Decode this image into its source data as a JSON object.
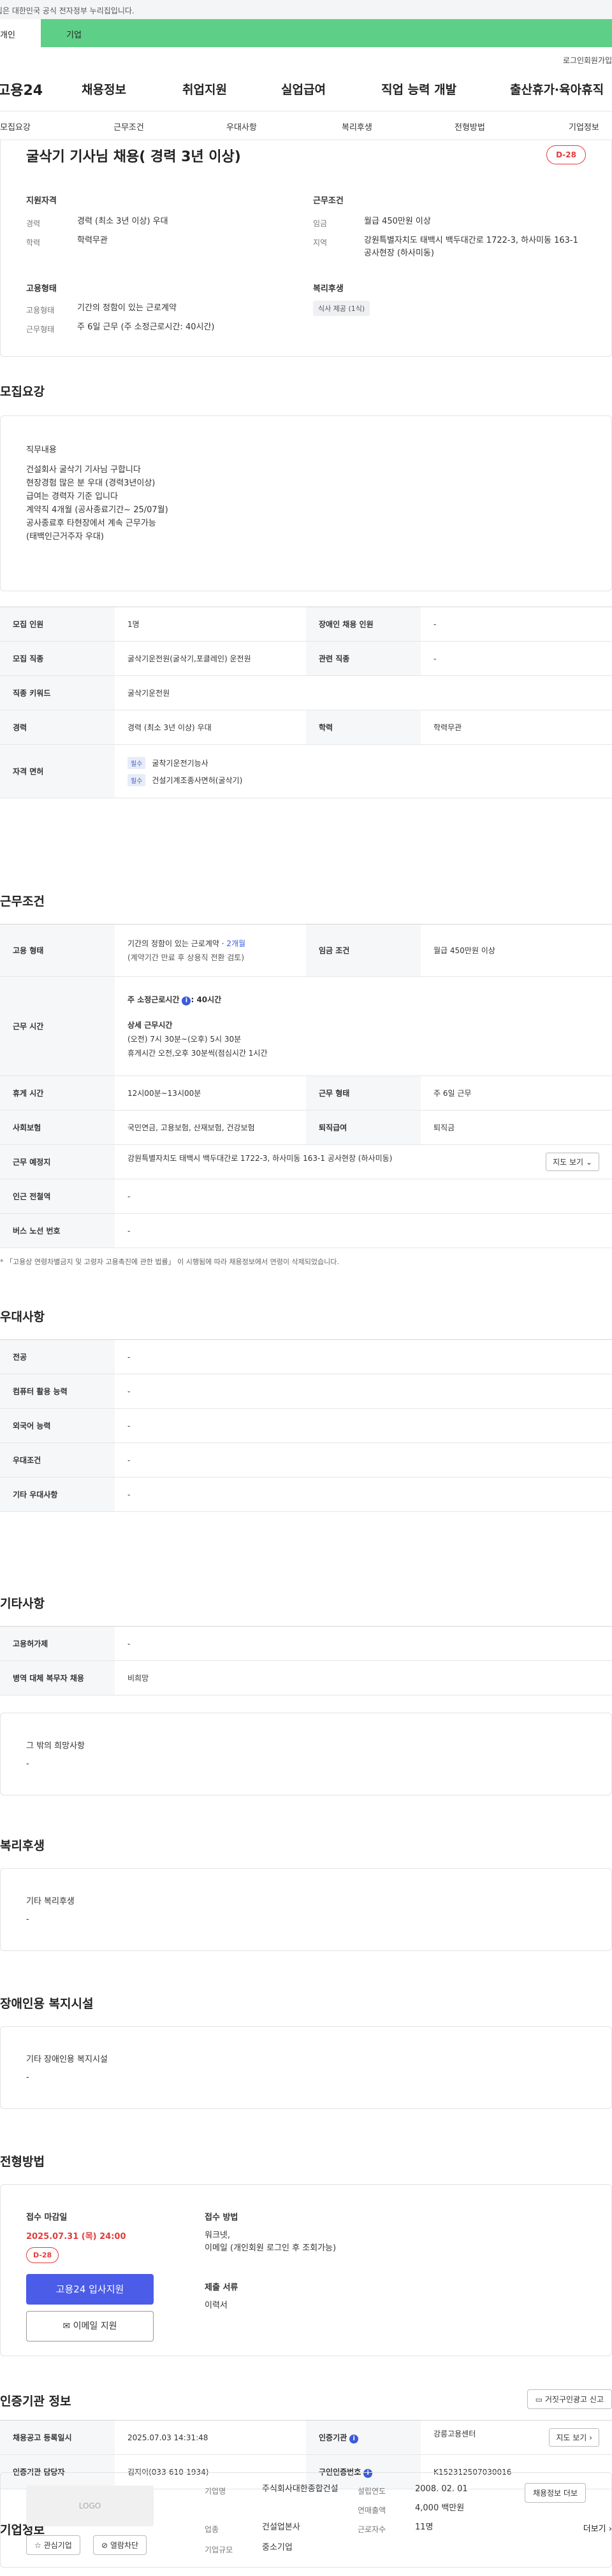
{
  "gov_banner": "이 누리집은 대한민국 공식 전자정부 누리집입니다.",
  "top_tabs": {
    "personal": "개인",
    "company": "기업"
  },
  "util": {
    "login": "로그인",
    "join": "회원가입"
  },
  "gnb": {
    "logo": "고용24",
    "menu": [
      "채용정보",
      "취업지원",
      "실업급여",
      "직업 능력 개발",
      "출산휴가·육아휴직"
    ]
  },
  "subnav": [
    "모집요강",
    "근무조건",
    "우대사항",
    "복리후생",
    "전형방법",
    "기업정보"
  ],
  "job": {
    "title": "굴삭기 기사님 채용( 경력 3년 이상)",
    "dday": "D-28",
    "qual_label": "지원자격",
    "career_k": "경력",
    "career_v": "경력 (최소 3년 이상) 우대",
    "edu_k": "학력",
    "edu_v": "학력무관",
    "work_label": "근무조건",
    "wage_k": "임금",
    "wage_v": "월급 450만원 이상",
    "region_k": "지역",
    "region_v": "강원특별자치도 태백시 백두대간로 1722-3, 하사미동 163-1 공사현장 (하사미동)",
    "emp_label": "고용형태",
    "emp_k": "고용형태",
    "emp_v": "기간의 정함이 있는 근로계약",
    "workform_k": "근무형태",
    "workform_v": "주 6일 근무 (주 소정근로시간: 40시간)",
    "welfare_label": "복리후생",
    "welfare_pill": "식사 제공 (1식)"
  },
  "recruit": {
    "heading": "모집요강",
    "duty_title": "직무내용",
    "duty_text": "건설회사 굴삭기 기사님 구합니다\n현장경험 많은 분 우대 (경력3년이상)\n급여는 경력자 기준 입니다\n계약직 4개월 (공사종료기간~ 25/07월)\n공사종료후 타현장에서 계속 근무가능\n(태백인근거주자 우대)",
    "rows": [
      [
        "모집 인원",
        "1명",
        "장애인 채용 인원",
        "-"
      ],
      [
        "모집 직종",
        "굴삭기운전원(굴삭기,포클레인) 운전원",
        "관련 직종",
        "-"
      ],
      [
        "직종 키워드",
        "굴삭기운전원",
        "",
        ""
      ],
      [
        "경력",
        "경력 (최소 3년 이상) 우대",
        "학력",
        "학력무관"
      ]
    ],
    "license_k": "자격 면허",
    "licenses": [
      "굴착기운전기능사",
      "건설기계조종사면허(굴삭기)"
    ],
    "required_tag": "필수"
  },
  "conditions": {
    "heading": "근무조건",
    "emp_k": "고용 형태",
    "emp_v1": "기간의 정함이 있는 근로계약 · ",
    "emp_v1_blue": "2개월",
    "emp_v2": "(계약기간 만료 후 상용직 전환 검토)",
    "wage_k": "임금 조건",
    "wage_v": "월급 450만원 이상",
    "hours_k": "근무 시간",
    "hours_prescribed": "주 소정근로시간",
    "hours_prescribed_v": ": 40시간",
    "hours_detail_title": "상세 근무시간",
    "hours_detail_1": "(오전) 7시 30분~(오후) 5시 30분",
    "hours_detail_2": "휴게시간 오전,오후 30분씩(점심시간 1시간",
    "break_k": "휴게 시간",
    "break_v": "12시00분~13시00분",
    "form_k": "근무 형태",
    "form_v": "주 6일 근무",
    "ins_k": "사회보험",
    "ins_v": "국민연금, 고용보험, 산재보험, 건강보험",
    "retire_k": "퇴직급여",
    "retire_v": "퇴직금",
    "place_k": "근무 예정지",
    "place_v": "강원특별자치도 태백시 백두대간로 1722-3, 하사미동 163-1 공사현장 (하사미동)",
    "map_btn": "지도 보기",
    "subway_k": "인근 전철역",
    "subway_v": "-",
    "bus_k": "버스 노선 번호",
    "bus_v": "-",
    "note": "* 「고용상 연령차별금지 및 고령자 고용촉진에 관한 법률」 이 시행됨에 따라 채용정보에서 연령이 삭제되었습니다."
  },
  "preference": {
    "heading": "우대사항",
    "rows": [
      [
        "전공",
        "-"
      ],
      [
        "컴퓨터 활용 능력",
        "-"
      ],
      [
        "외국어 능력",
        "-"
      ],
      [
        "우대조건",
        "-"
      ],
      [
        "기타 우대사항",
        "-"
      ]
    ]
  },
  "etc": {
    "heading": "기타사항",
    "rows": [
      [
        "고용허가제",
        "-"
      ],
      [
        "병역 대체 복무자 채용",
        "비희망"
      ]
    ],
    "other_title": "그 밖의 희망사항",
    "other_v": "-"
  },
  "welfare": {
    "heading": "복리후생",
    "title": "기타 복리후생",
    "v": "-"
  },
  "disabled": {
    "heading": "장애인용 복지시설",
    "title": "기타 장애인용 복지시설",
    "v": "-"
  },
  "screening": {
    "heading": "전형방법",
    "deadline_k": "접수 마감일",
    "deadline_v": "2025.07.31 (목) 24:00",
    "dday": "D-28",
    "apply_btn": "고용24 입사지원",
    "email_btn": "이메일 지원",
    "method_k": "접수 방법",
    "method_v": "워크넷,\n이메일 (개인회원 로그인 후 조회가능)",
    "docs_k": "제출 서류",
    "docs_v": "이력서"
  },
  "certifier": {
    "heading": "인증기관 정보",
    "report_btn": "거짓구인광고 신고",
    "reg_k": "채용공고 등록일시",
    "reg_v": "2025.07.03 14:31:48",
    "org_k": "인증기관",
    "org_v": "강릉고용센터",
    "map_btn": "지도 보기",
    "mgr_k": "인증기관 담당자",
    "mgr_v": "김지이(033-610-1934)",
    "num_k": "구인인증번호",
    "num_v": "K152312507030016"
  },
  "company": {
    "heading": "기업정보",
    "more": "더보기",
    "logo": "LOGO",
    "interest_btn": "관심기업",
    "block_btn": "열람차단",
    "name_k": "기업명",
    "name_v": "주식회사대한종합건설",
    "industry_k": "업종",
    "industry_v": "건설업본사",
    "scale_k": "기업규모",
    "scale_v": "중소기업",
    "founded_k": "설립연도",
    "founded_v": "2008. 02. 01",
    "sales_k": "연매출액",
    "sales_v": "4,000 백만원",
    "employees_k": "근로자수",
    "employees_v": "11명",
    "jobs_btn": "채용정보 더보"
  }
}
